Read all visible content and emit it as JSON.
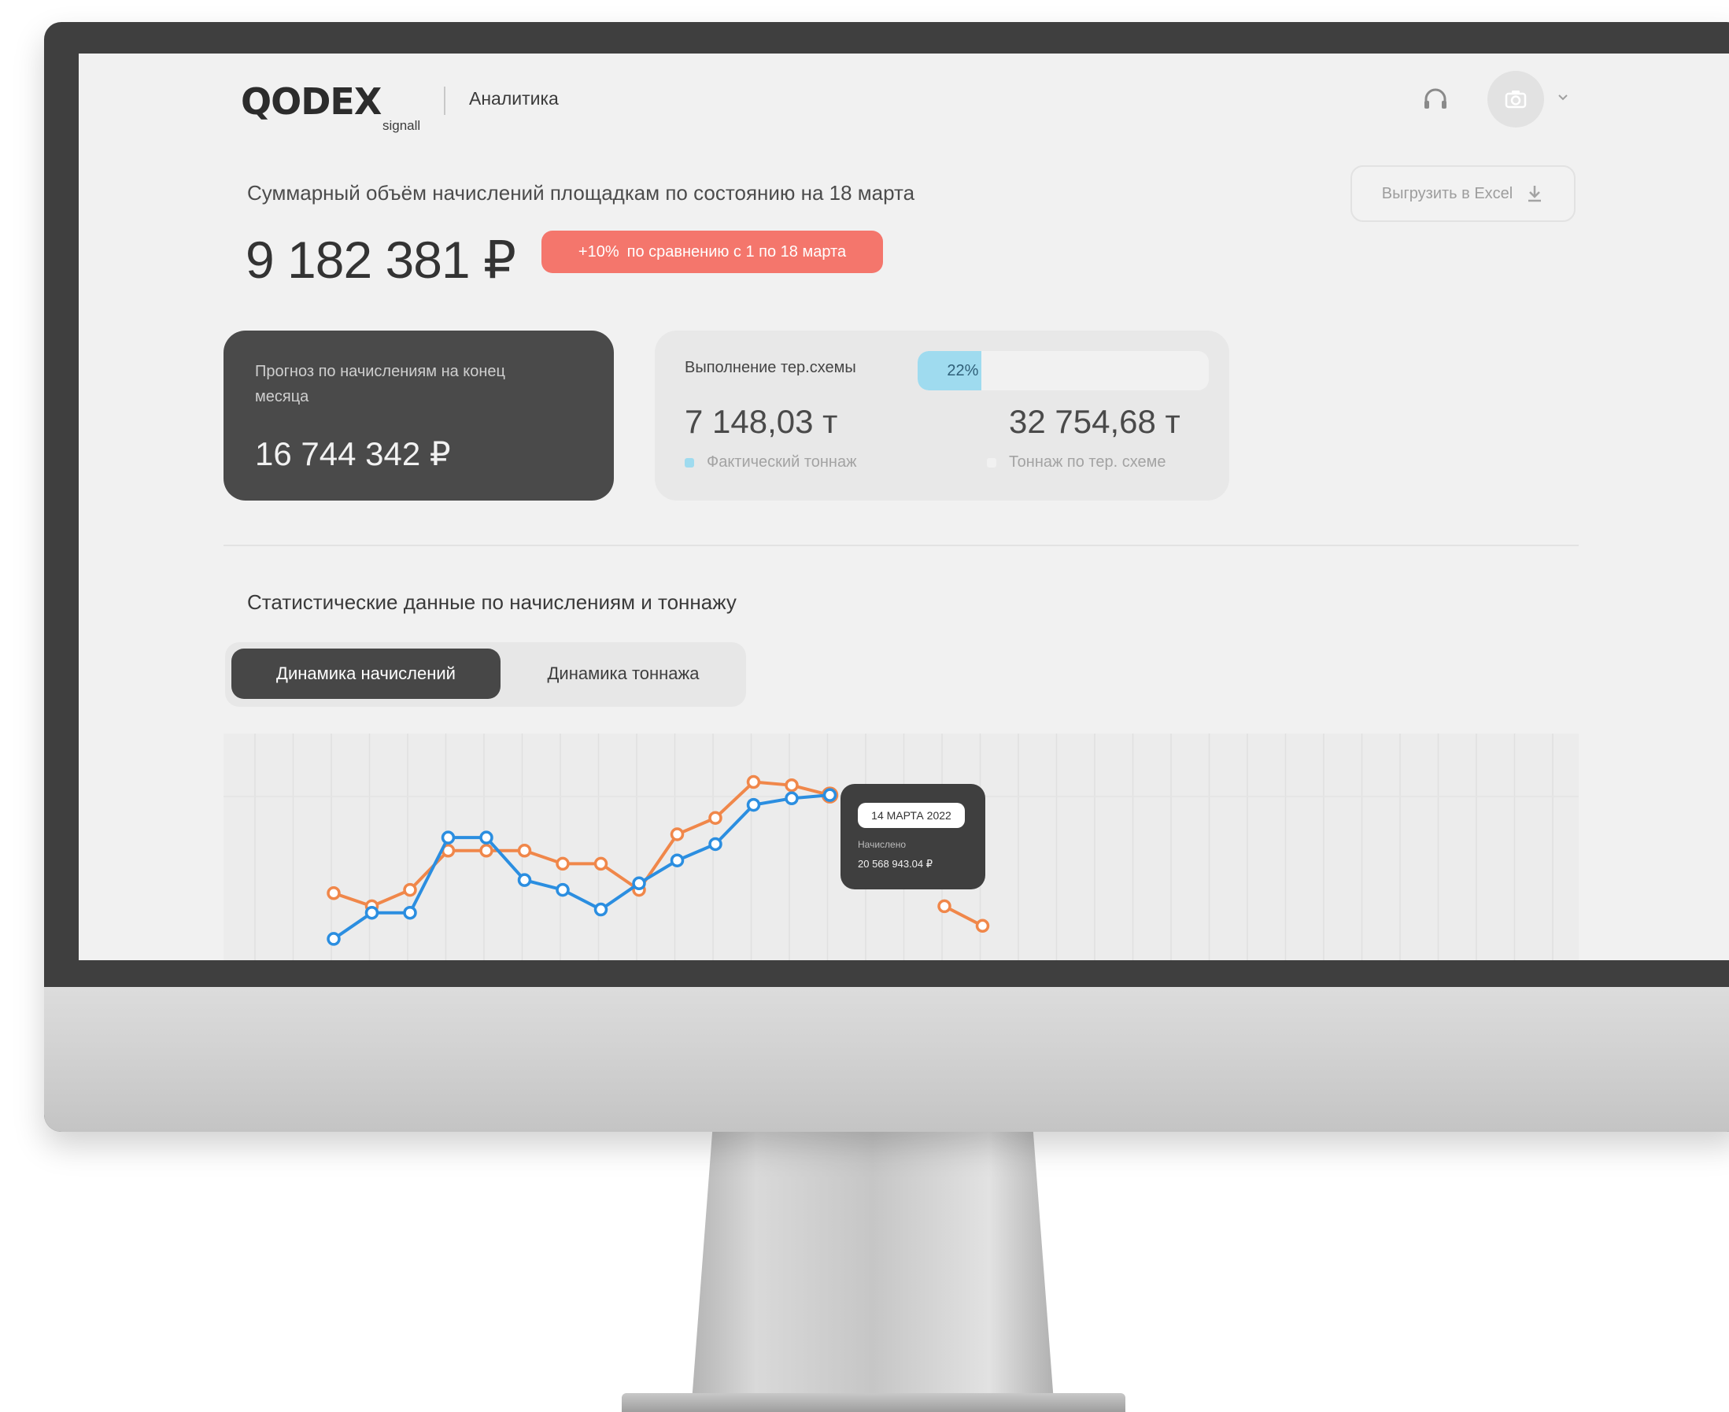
{
  "header": {
    "logo_text": "QODEX",
    "logo_sub": "signall",
    "section": "Аналитика"
  },
  "summary": {
    "title": "Суммарный объём начислений площадкам по состоянию на 18 марта",
    "total": "9 182 381 ₽",
    "badge_change": "+10%",
    "badge_text": "по сравнению с 1 по 18 марта",
    "export_label": "Выгрузить в Excel"
  },
  "forecast": {
    "label": "Прогноз по начислениям на конец месяца",
    "value": "16 744 342 ₽"
  },
  "scheme": {
    "title": "Выполнение тер.схемы",
    "progress_label": "22%",
    "progress_value": 0.22,
    "actual_value": "7 148,03 т",
    "actual_label": "Фактический тоннаж",
    "plan_value": "32 754,68 т",
    "plan_label": "Тоннаж по тер. схеме"
  },
  "stats": {
    "title": "Статистические данные по начислениям и тоннажу",
    "tabs": [
      "Динамика начислений",
      "Динамика тоннажа"
    ]
  },
  "tooltip": {
    "date": "14 МАРТА 2022",
    "label": "Начислено",
    "value": "20 568 943.04 ₽"
  },
  "colors": {
    "accent_blue": "#2b8ee0",
    "accent_orange": "#f0874a",
    "badge_red": "#f4766c",
    "progress_blue": "#9fdbef",
    "logo_green": "#9bc53d"
  },
  "chart_data": {
    "type": "line",
    "x": [
      1,
      2,
      3,
      4,
      5,
      6,
      7,
      8,
      9,
      10,
      11,
      12,
      13,
      14,
      15,
      16,
      17,
      18
    ],
    "series": [
      {
        "color": "#2b8ee0",
        "values": [
          16.2,
          17.0,
          17.0,
          19.3,
          19.3,
          18.0,
          17.7,
          17.1,
          17.9,
          18.6,
          19.1,
          20.3,
          20.5,
          20.6
        ]
      },
      {
        "color": "#f0874a",
        "values": [
          17.6,
          17.2,
          17.7,
          18.9,
          18.9,
          18.9,
          18.5,
          18.5,
          17.7,
          19.4,
          19.9,
          21.0,
          20.9,
          20.6,
          null,
          null,
          17.2,
          16.6
        ]
      }
    ],
    "highlight_index": 13,
    "ylim": [
      15.5,
      22.0
    ],
    "grid": true
  }
}
